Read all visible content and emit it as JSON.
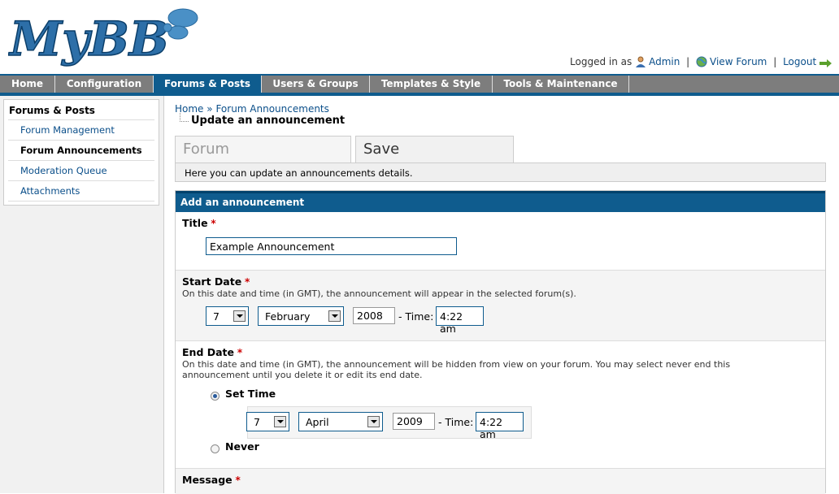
{
  "header": {
    "logo_text": "MyBB",
    "logged_in_as": "Logged in as",
    "user_link": "Admin",
    "view_forum": "View Forum",
    "logout": "Logout",
    "sep": "|"
  },
  "menu": [
    "Home",
    "Configuration",
    "Forums & Posts",
    "Users & Groups",
    "Templates & Style",
    "Tools & Maintenance"
  ],
  "sidebar": {
    "title": "Forums & Posts",
    "items": [
      "Forum Management",
      "Forum Announcements",
      "Moderation Queue",
      "Attachments"
    ]
  },
  "breadcrumb": {
    "home": "Home",
    "sep": "»",
    "current": "Forum Announcements"
  },
  "page_title": "Update an announcement",
  "tabs": [
    "Forum Announcements",
    "Save Announcement"
  ],
  "description": "Here you can update an announcements details.",
  "form": {
    "header": "Add an announcement",
    "title": {
      "label": "Title",
      "req": "*",
      "value": "Example Announcement"
    },
    "start": {
      "label": "Start Date",
      "req": "*",
      "hint": "On this date and time (in GMT), the announcement will appear in the selected forum(s).",
      "day": "7",
      "month": "February",
      "year": "2008",
      "time_label": "- Time:",
      "time": "4:22 am"
    },
    "end": {
      "label": "End Date",
      "req": "*",
      "hint": "On this date and time (in GMT), the announcement will be hidden from view on your forum. You may select never end this announcement until you delete it or edit its end date.",
      "set_time": "Set Time",
      "never": "Never",
      "day": "7",
      "month": "April",
      "year": "2009",
      "time_label": "- Time:",
      "time": "4:22 am"
    },
    "message": {
      "label": "Message",
      "req": "*"
    }
  },
  "colors": {
    "accent": "#0f5c8e",
    "menu": "#7d7d7d"
  }
}
